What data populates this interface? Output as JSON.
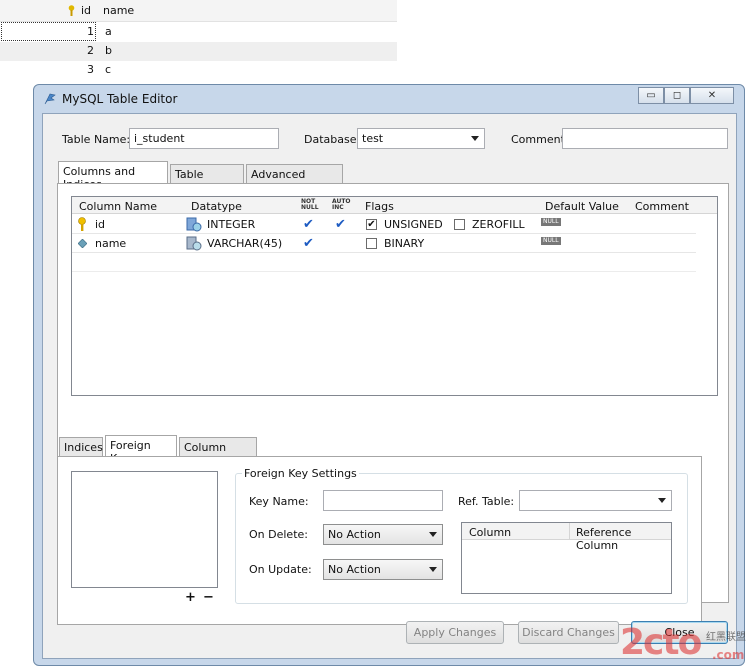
{
  "background_grid": {
    "headers": [
      "id",
      "name"
    ],
    "rows": [
      {
        "num": "1",
        "value": "a"
      },
      {
        "num": "2",
        "value": "b"
      },
      {
        "num": "3",
        "value": "c"
      }
    ]
  },
  "window": {
    "title": "MySQL Table Editor",
    "controls": {
      "minimize": "▭",
      "maximize": "◻",
      "close": "✕"
    }
  },
  "form": {
    "table_name_label": "Table Name:",
    "table_name_value": "i_student",
    "database_label": "Database:",
    "database_value": "test",
    "comment_label": "Comment:",
    "comment_value": ""
  },
  "tabs": [
    "Columns and Indices",
    "Table Options",
    "Advanced Options"
  ],
  "columns_grid": {
    "headers": {
      "column_name": "Column Name",
      "datatype": "Datatype",
      "not_null": [
        "NOT",
        "NULL"
      ],
      "auto_inc": [
        "AUTO",
        "INC"
      ],
      "flags": "Flags",
      "default_value": "Default Value",
      "comment": "Comment"
    },
    "rows": [
      {
        "name": "id",
        "datatype": "INTEGER",
        "flag1": "UNSIGNED",
        "flag2": "ZEROFILL",
        "default": "NULL"
      },
      {
        "name": "name",
        "datatype": "VARCHAR(45)",
        "flag1": "BINARY",
        "default": "NULL"
      }
    ]
  },
  "sub_tabs": [
    "Indices",
    "Foreign Keys",
    "Column Details"
  ],
  "foreign_keys": {
    "group_title": "Foreign Key Settings",
    "key_name_label": "Key Name:",
    "key_name_value": "",
    "ref_table_label": "Ref. Table:",
    "ref_table_value": "",
    "on_delete_label": "On Delete:",
    "on_delete_value": "No Action",
    "on_update_label": "On Update:",
    "on_update_value": "No Action",
    "ref_col_headers": [
      "Column",
      "Reference Column"
    ],
    "add_symbol": "+",
    "remove_symbol": "−"
  },
  "buttons": {
    "apply": "Apply Changes",
    "discard": "Discard Changes",
    "close": "Close"
  },
  "watermark": {
    "big": "2cto",
    "sub": "红黑联盟",
    "domain": ".com"
  }
}
